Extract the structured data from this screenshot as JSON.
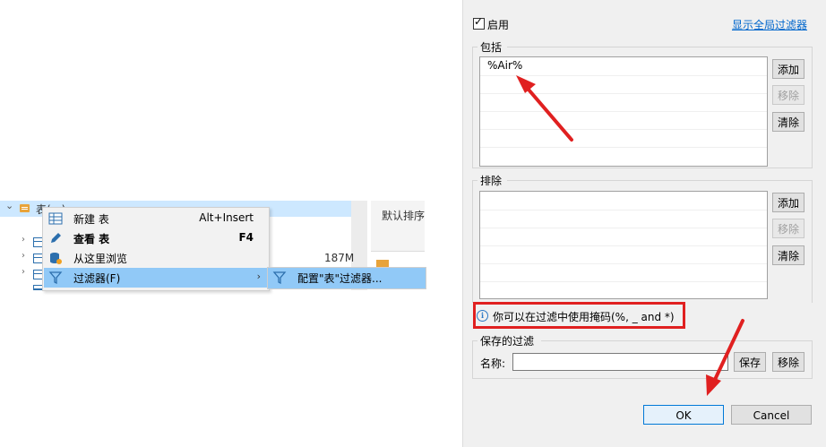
{
  "tree": {
    "root_label": "表(…)",
    "size_label": "187M",
    "column_header": "默认排序"
  },
  "context_menu": {
    "items": [
      {
        "label": "新建 表",
        "shortcut": "Alt+Insert"
      },
      {
        "label": "查看 表",
        "shortcut": "F4"
      },
      {
        "label": "从这里浏览",
        "shortcut": ""
      },
      {
        "label": "过滤器(F)",
        "shortcut": ""
      }
    ],
    "submenu_label": "配置\"表\"过滤器..."
  },
  "dialog": {
    "enable_label": "启用",
    "enabled": true,
    "show_global_filters_link": "显示全局过滤器",
    "include": {
      "title": "包括",
      "items": [
        "%Air%"
      ],
      "buttons": {
        "add": "添加",
        "remove": "移除",
        "clear": "清除"
      }
    },
    "exclude": {
      "title": "排除",
      "items": [],
      "buttons": {
        "add": "添加",
        "remove": "移除",
        "clear": "清除"
      }
    },
    "info_text": "你可以在过滤中使用掩码(%, _ and *)",
    "saved_filters": {
      "title": "保存的过滤",
      "name_label": "名称:",
      "name_value": "",
      "save_button": "保存",
      "remove_button": "移除"
    },
    "ok_button": "OK",
    "cancel_button": "Cancel"
  },
  "colors": {
    "highlight": "#91c9f7",
    "tree_selection": "#cde8ff",
    "annotation_red": "#e02020",
    "link_blue": "#0066cc"
  }
}
